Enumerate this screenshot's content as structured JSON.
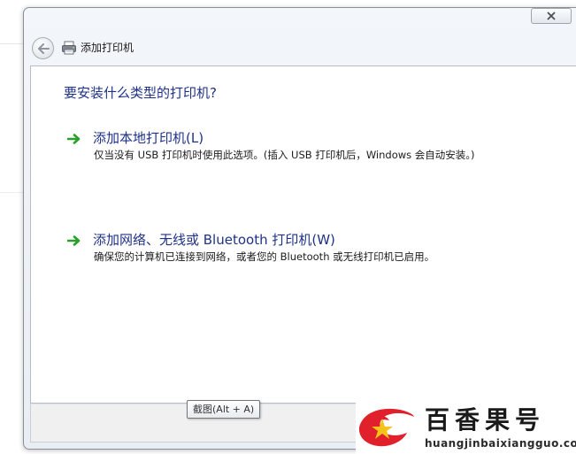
{
  "window": {
    "title": "添加打印机",
    "title_icon": "printer-icon",
    "back_icon": "back-arrow-icon",
    "close_icon": "close-icon"
  },
  "main": {
    "heading": "要安装什么类型的打印机?",
    "options": [
      {
        "icon": "green-arrow-icon",
        "title": "添加本地打印机(L)",
        "description": "仅当没有 USB 打印机时使用此选项。(插入 USB 打印机后，Windows 会自动安装。)"
      },
      {
        "icon": "green-arrow-icon",
        "title": "添加网络、无线或 Bluetooth 打印机(W)",
        "description": "确保您的计算机已连接到网络，或者您的 Bluetooth 或无线打印机已启用。"
      }
    ]
  },
  "tooltip": {
    "text": "截图(Alt + A)"
  },
  "watermark": {
    "name": "百香果号",
    "url": "huangjinbaixiangguo.com"
  },
  "colors": {
    "link_blue": "#1e3287",
    "arrow_green": "#2aa02a",
    "watermark_red": "#e0202a",
    "watermark_star": "#f7c21a"
  }
}
